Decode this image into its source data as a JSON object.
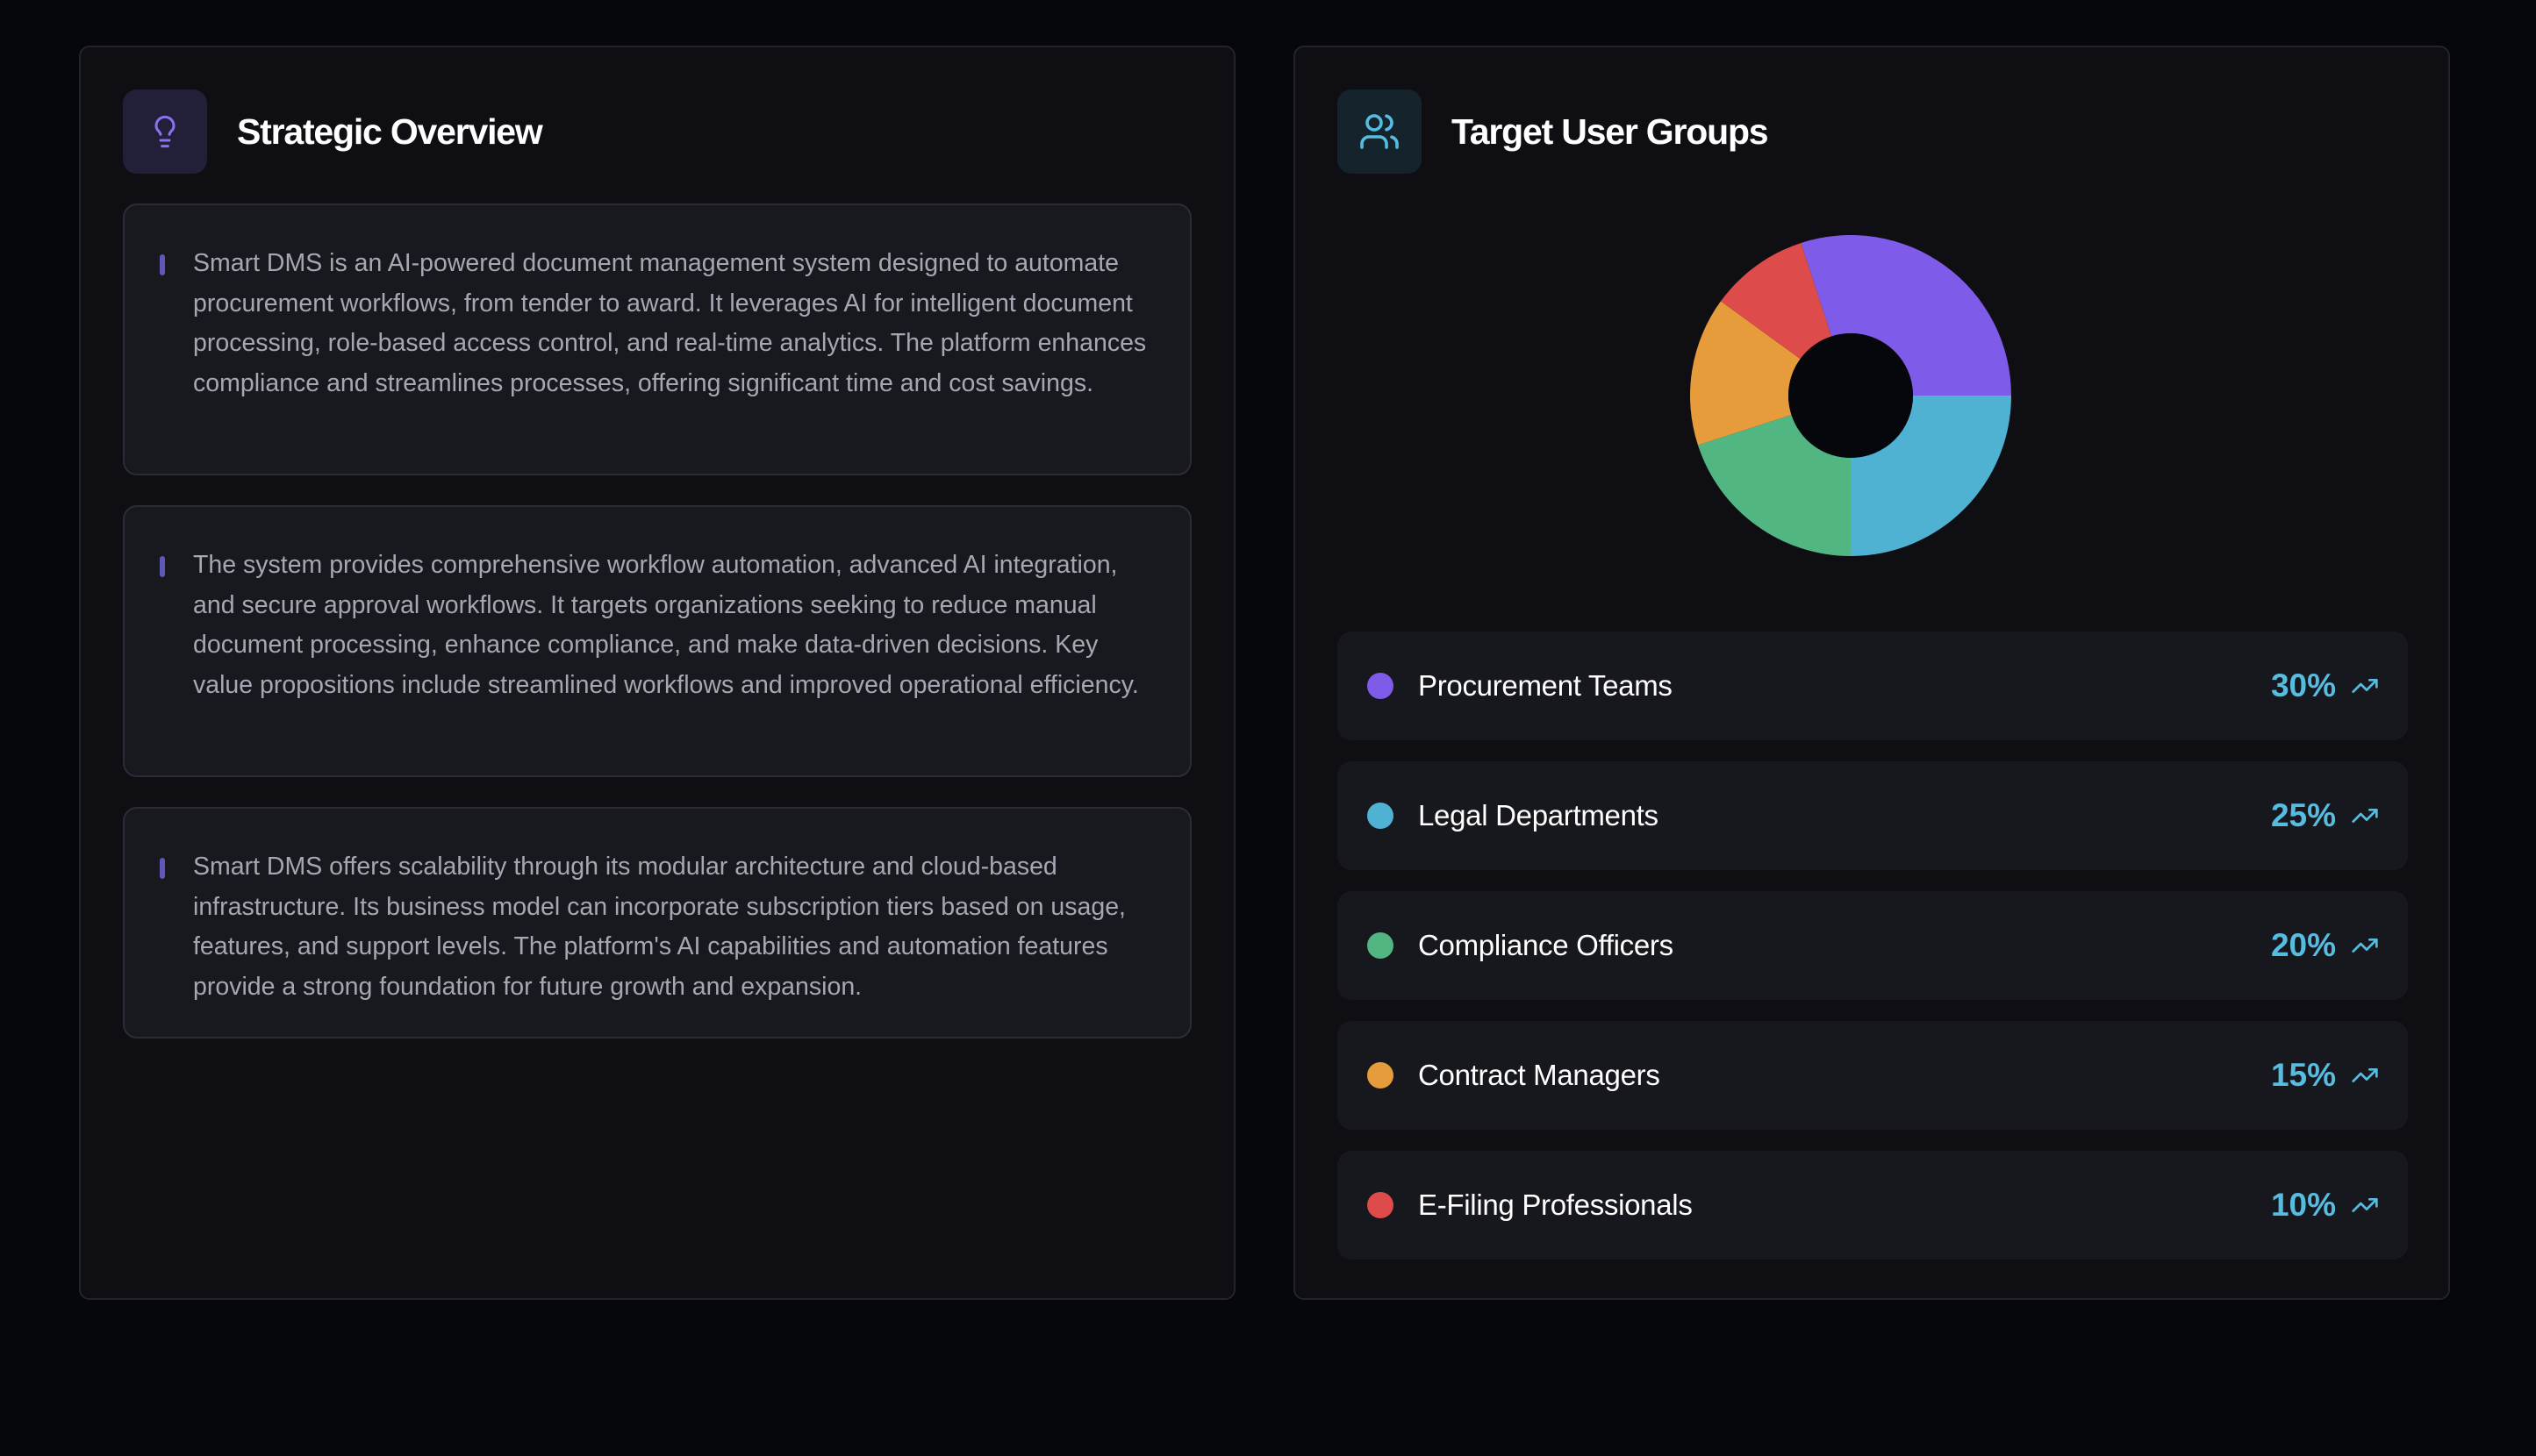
{
  "overview": {
    "title": "Strategic Overview",
    "icon": "lightbulb-icon",
    "paragraphs": [
      "Smart DMS is an AI-powered document management system designed to automate procurement workflows, from tender to award. It leverages AI for intelligent document processing, role-based access control, and real-time analytics. The platform enhances compliance and streamlines processes, offering significant time and cost savings.",
      "The system provides comprehensive workflow automation, advanced AI integration, and secure approval workflows. It targets organizations seeking to reduce manual document processing, enhance compliance, and make data-driven decisions. Key value propositions include streamlined workflows and improved operational efficiency.",
      "Smart DMS offers scalability through its modular architecture and cloud-based infrastructure. Its business model can incorporate subscription tiers based on usage, features, and support levels. The platform's AI capabilities and automation features provide a strong foundation for future growth and expansion."
    ]
  },
  "targets": {
    "title": "Target User Groups",
    "icon": "users-icon",
    "trend_icon": "trending-up-icon",
    "groups": [
      {
        "label": "Procurement Teams",
        "percent": "30%",
        "color": "#7f5bea"
      },
      {
        "label": "Legal Departments",
        "percent": "25%",
        "color": "#4fb2d3"
      },
      {
        "label": "Compliance Officers",
        "percent": "20%",
        "color": "#52b683"
      },
      {
        "label": "Contract Managers",
        "percent": "15%",
        "color": "#e79c3b"
      },
      {
        "label": "E-Filing Professionals",
        "percent": "10%",
        "color": "#dd4b4a"
      }
    ]
  },
  "chart_data": {
    "type": "pie",
    "categories": [
      "Procurement Teams",
      "Legal Departments",
      "Compliance Officers",
      "Contract Managers",
      "E-Filing Professionals"
    ],
    "values": [
      30,
      25,
      20,
      15,
      10
    ],
    "colors": [
      "#7f5bea",
      "#4fb2d3",
      "#52b683",
      "#e79c3b",
      "#dd4b4a"
    ]
  },
  "theme": {
    "background": "#05070d",
    "panel": "#0e0e13",
    "accent_purple": "#8a72f0",
    "accent_teal": "#56bce0"
  }
}
